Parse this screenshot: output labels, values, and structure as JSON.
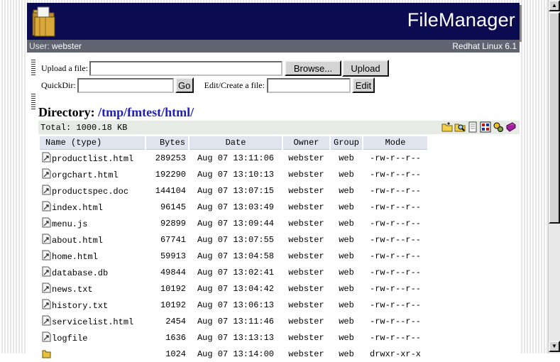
{
  "app": {
    "title": "FileManager",
    "user_label": "User:",
    "user": "webster",
    "os": "Redhat Linux 6.1"
  },
  "upload": {
    "label": "Upload a file:",
    "value": "",
    "browse_label": "Browse...",
    "upload_label": "Upload"
  },
  "quickdir": {
    "label": "QuickDir:",
    "value": "",
    "go_label": "Go"
  },
  "edit": {
    "label": "Edit/Create a file:",
    "value": "",
    "edit_label": "Edit"
  },
  "directory": {
    "label": "Directory:",
    "path": "/tmp/fmtest/html/",
    "total": "Total: 1000.18 KB"
  },
  "toolbar_icons": [
    "new-folder-icon",
    "search-icon",
    "new-file-icon",
    "grid-view-icon",
    "settings-icon",
    "book-icon"
  ],
  "table": {
    "headers": [
      "Name (type)",
      "Bytes",
      "Date",
      "Owner",
      "Group",
      "Mode"
    ],
    "rows": [
      {
        "name": "productlist.html",
        "bytes": "289253",
        "date": "Aug 07 13:11:06",
        "owner": "webster",
        "group": "web",
        "mode": "-rw-r--r--"
      },
      {
        "name": "orgchart.html",
        "bytes": "192290",
        "date": "Aug 07 13:10:13",
        "owner": "webster",
        "group": "web",
        "mode": "-rw-r--r--"
      },
      {
        "name": "productspec.doc",
        "bytes": "144104",
        "date": "Aug 07 13:07:15",
        "owner": "webster",
        "group": "web",
        "mode": "-rw-r--r--"
      },
      {
        "name": "index.html",
        "bytes": "96145",
        "date": "Aug 07 13:03:49",
        "owner": "webster",
        "group": "web",
        "mode": "-rw-r--r--"
      },
      {
        "name": "menu.js",
        "bytes": "92899",
        "date": "Aug 07 13:09:44",
        "owner": "webster",
        "group": "web",
        "mode": "-rw-r--r--"
      },
      {
        "name": "about.html",
        "bytes": "67741",
        "date": "Aug 07 13:07:55",
        "owner": "webster",
        "group": "web",
        "mode": "-rw-r--r--"
      },
      {
        "name": "home.html",
        "bytes": "59913",
        "date": "Aug 07 13:04:58",
        "owner": "webster",
        "group": "web",
        "mode": "-rw-r--r--"
      },
      {
        "name": "database.db",
        "bytes": "49844",
        "date": "Aug 07 13:02:41",
        "owner": "webster",
        "group": "web",
        "mode": "-rw-r--r--"
      },
      {
        "name": "news.txt",
        "bytes": "10192",
        "date": "Aug 07 13:04:42",
        "owner": "webster",
        "group": "web",
        "mode": "-rw-r--r--"
      },
      {
        "name": "history.txt",
        "bytes": "10192",
        "date": "Aug 07 13:06:13",
        "owner": "webster",
        "group": "web",
        "mode": "-rw-r--r--"
      },
      {
        "name": "servicelist.html",
        "bytes": "2454",
        "date": "Aug 07 13:11:46",
        "owner": "webster",
        "group": "web",
        "mode": "-rw-r--r--"
      },
      {
        "name": "logfile",
        "bytes": "1636",
        "date": "Aug 07 13:13:13",
        "owner": "webster",
        "group": "web",
        "mode": "-rw-r--r--"
      },
      {
        "name": "",
        "bytes": "1024",
        "date": "Aug 07 13:14:00",
        "owner": "webster",
        "group": "web",
        "mode": "drwxr-xr-x",
        "is_folder": true
      }
    ]
  },
  "colors": {
    "banner": "#0b0b52",
    "userbar": "#606370",
    "path_link": "#1f1fbf",
    "header_cell": "#dfe4ef",
    "total_bar": "#e6ebe6"
  }
}
